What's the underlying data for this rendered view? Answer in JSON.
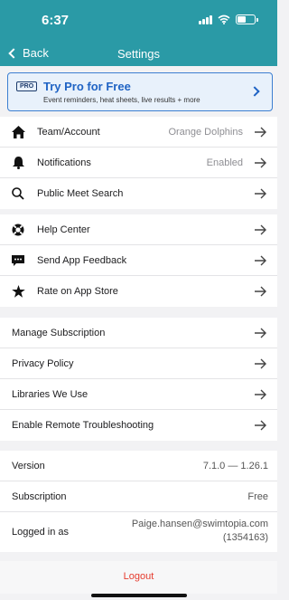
{
  "status": {
    "time": "6:37"
  },
  "nav": {
    "back_label": "Back",
    "title": "Settings"
  },
  "pro_banner": {
    "badge": "PRO",
    "title": "Try Pro for Free",
    "subtitle": "Event reminders, heat sheets, live results + more"
  },
  "group1": [
    {
      "icon": "home-icon",
      "label": "Team/Account",
      "value": "Orange Dolphins"
    },
    {
      "icon": "bell-icon",
      "label": "Notifications",
      "value": "Enabled"
    },
    {
      "icon": "search-icon",
      "label": "Public Meet Search",
      "value": ""
    }
  ],
  "group2": [
    {
      "icon": "lifebuoy-icon",
      "label": "Help Center"
    },
    {
      "icon": "chat-bubble-icon",
      "label": "Send App Feedback"
    },
    {
      "icon": "star-icon",
      "label": "Rate on App Store"
    }
  ],
  "group3": [
    {
      "label": "Manage Subscription"
    },
    {
      "label": "Privacy Policy"
    },
    {
      "label": "Libraries We Use"
    },
    {
      "label": "Enable Remote Troubleshooting"
    }
  ],
  "info": {
    "version_label": "Version",
    "version_value": "7.1.0 — 1.26.1",
    "subscription_label": "Subscription",
    "subscription_value": "Free",
    "logged_label": "Logged in as",
    "logged_email": "Paige.hansen@swimtopia.com",
    "logged_id": "(1354163)"
  },
  "logout_label": "Logout",
  "colors": {
    "header": "#2a9aa6",
    "accent": "#1f63c4",
    "logout": "#e53b2e"
  }
}
